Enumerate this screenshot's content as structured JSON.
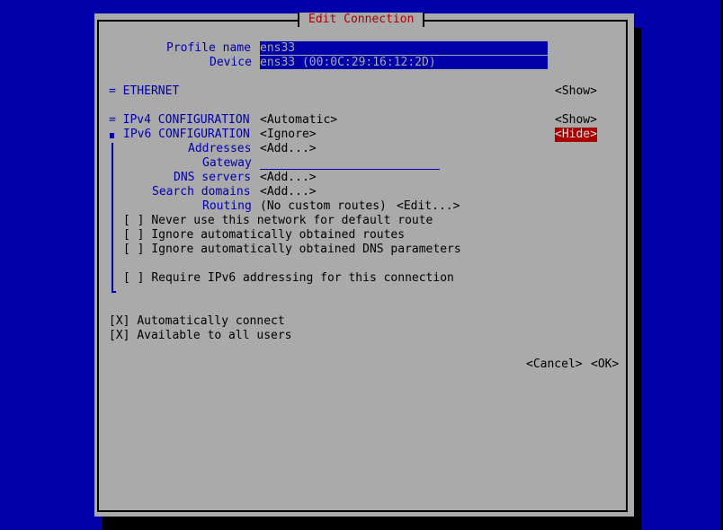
{
  "dialog": {
    "title": "Edit Connection",
    "profile_name_label": "Profile name",
    "profile_name_value": "ens33",
    "device_label": "Device",
    "device_value": "ens33 (00:0C:29:16:12:2D)"
  },
  "ethernet": {
    "label": "= ETHERNET",
    "toggle": "<Show>"
  },
  "ipv4": {
    "label": "= IPv4 CONFIGURATION",
    "method": "<Automatic>",
    "toggle": "<Show>"
  },
  "ipv6": {
    "label": "IPv6 CONFIGURATION",
    "method": "<Ignore>",
    "toggle": "<Hide>",
    "addresses_label": "Addresses",
    "addresses_button": "<Add...>",
    "gateway_label": "Gateway",
    "gateway_value": "",
    "dns_label": "DNS servers",
    "dns_button": "<Add...>",
    "search_label": "Search domains",
    "search_button": "<Add...>",
    "routing_label": "Routing",
    "routing_value": "(No custom routes)",
    "routing_button": "<Edit...>",
    "checkboxes": [
      {
        "mark": "[ ]",
        "label": "Never use this network for default route",
        "checked": false
      },
      {
        "mark": "[ ]",
        "label": "Ignore automatically obtained routes",
        "checked": false
      },
      {
        "mark": "[ ]",
        "label": "Ignore automatically obtained DNS parameters",
        "checked": false
      },
      {
        "mark": "[ ]",
        "label": "Require IPv6 addressing for this connection",
        "checked": false
      }
    ]
  },
  "options": [
    {
      "mark": "[X]",
      "label": "Automatically connect",
      "checked": true
    },
    {
      "mark": "[X]",
      "label": "Available to all users",
      "checked": true
    }
  ],
  "buttons": {
    "cancel": "<Cancel>",
    "ok": "<OK>"
  },
  "colors": {
    "background": "#0000aa",
    "dialog": "#aaaaaa",
    "title": "#aa0000",
    "focus": "#aa0000"
  }
}
